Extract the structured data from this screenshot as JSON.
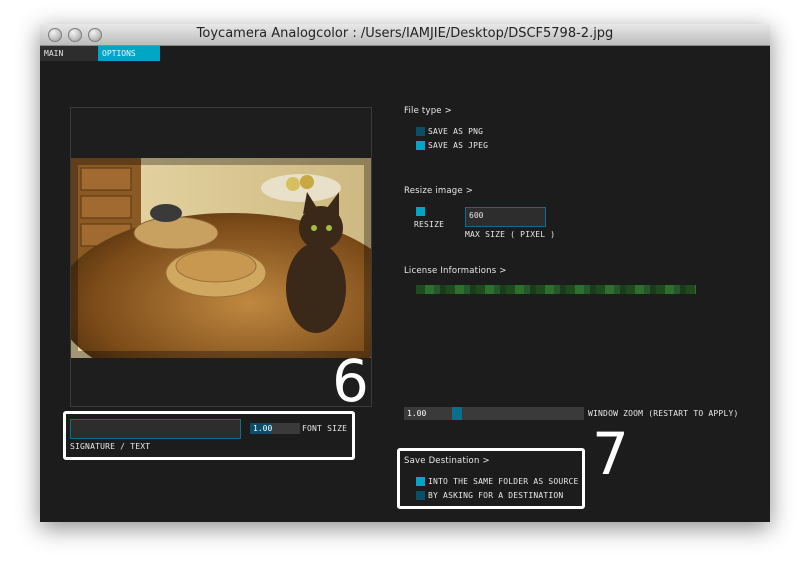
{
  "window": {
    "title": "Toycamera Analogcolor : /Users/IAMJIE/Desktop/DSCF5798-2.jpg"
  },
  "tabs": [
    {
      "label": "MAIN",
      "active": false
    },
    {
      "label": "OPTIONS",
      "active": true
    }
  ],
  "colors": {
    "accent": "#00a6c4",
    "checkbox_off": "#0b4e6a",
    "background": "#1c1c1c"
  },
  "file_type": {
    "title": "File type >",
    "options": [
      {
        "label": "SAVE AS PNG",
        "checked": false
      },
      {
        "label": "SAVE AS JPEG",
        "checked": true
      }
    ]
  },
  "resize": {
    "title": "Resize image >",
    "checkbox_label": "RESIZE",
    "checked": true,
    "max_size_value": "600",
    "max_size_label": "MAX SIZE ( PIXEL )"
  },
  "license": {
    "title": "License Informations >"
  },
  "zoom": {
    "value": "1.00",
    "label": "WINDOW ZOOM (RESTART TO APPLY)"
  },
  "save_destination": {
    "title": "Save Destination >",
    "options": [
      {
        "label": "INTO THE SAME FOLDER AS SOURCE",
        "checked": true
      },
      {
        "label": "BY ASKING FOR A DESTINATION",
        "checked": false
      }
    ]
  },
  "signature": {
    "text_value": "",
    "text_label": "SIGNATURE / TEXT",
    "font_size_value": "1.00",
    "font_size_label": "FONT SIZE"
  },
  "annotations": {
    "left": "6",
    "right": "7"
  }
}
